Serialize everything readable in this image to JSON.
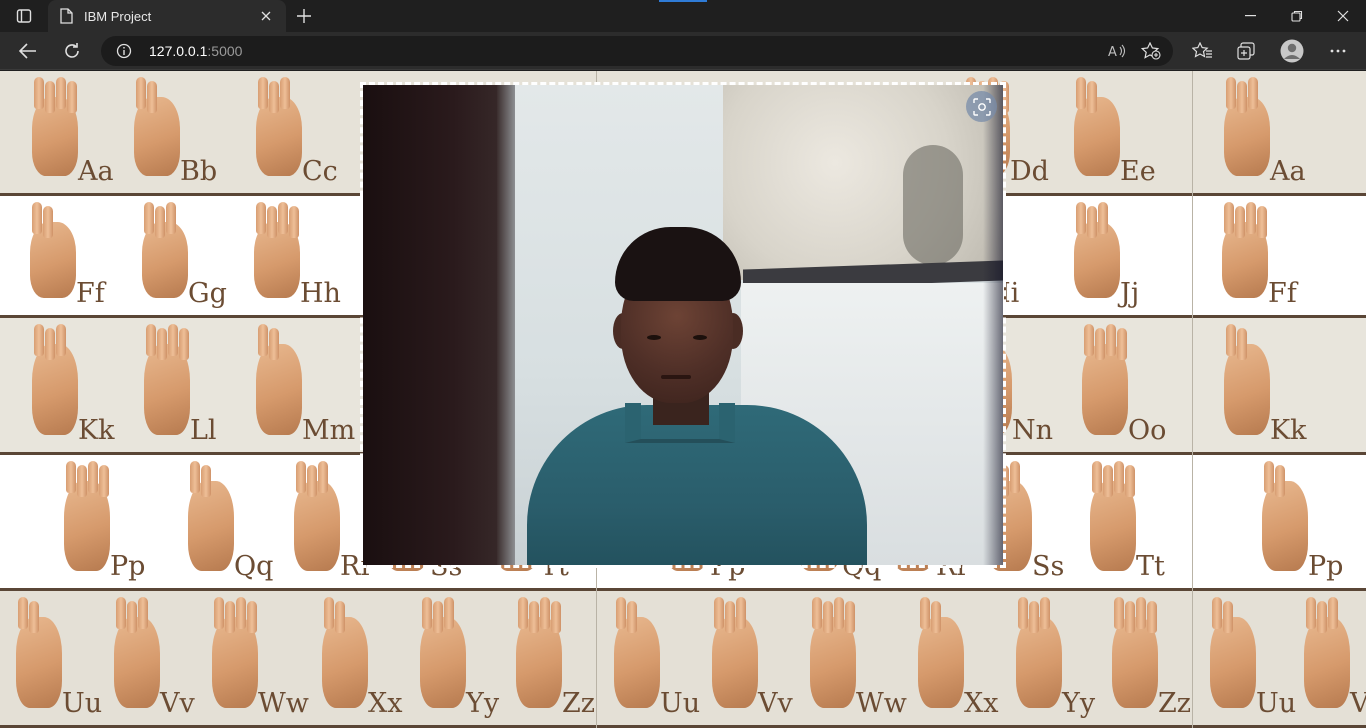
{
  "browser": {
    "tab_title": "IBM Project",
    "url_host": "127.0.0.1",
    "url_port": ":5000",
    "accent_color": "#2f7bd6"
  },
  "icons": {
    "tab_actions": "tab-actions-icon",
    "favicon": "page-icon",
    "tab_close": "close-icon",
    "new_tab": "plus-icon",
    "minimize": "minimize-icon",
    "restore": "restore-icon",
    "window_close": "close-icon",
    "back": "back-arrow-icon",
    "refresh": "refresh-icon",
    "site_info": "info-icon",
    "read_aloud": "read-aloud-icon",
    "add_favorite": "star-plus-icon",
    "favorites": "favorites-icon",
    "collections": "collections-icon",
    "profile": "profile-icon",
    "more": "more-icon",
    "visual_search": "visual-search-icon"
  },
  "asl_chart": {
    "row1": [
      "Aa",
      "Bb",
      "Cc",
      "Dd",
      "Ee",
      "Aa"
    ],
    "row2": [
      "Ff",
      "Gg",
      "Hh",
      "Ii",
      "Jj",
      "Ff"
    ],
    "row3": [
      "Kk",
      "Ll",
      "Mm",
      "Nn",
      "Oo",
      "Kk"
    ],
    "row4": [
      "Pp",
      "Qq",
      "Rr",
      "Ss",
      "Tt",
      "Pp",
      "Qq",
      "Rr",
      "Ss",
      "Tt",
      "Pp"
    ],
    "row5": [
      "Uu",
      "Vv",
      "Ww",
      "Xx",
      "Yy",
      "Zz",
      "Uu",
      "Vv",
      "Ww",
      "Xx",
      "Yy",
      "Zz",
      "Uu",
      "V"
    ]
  }
}
